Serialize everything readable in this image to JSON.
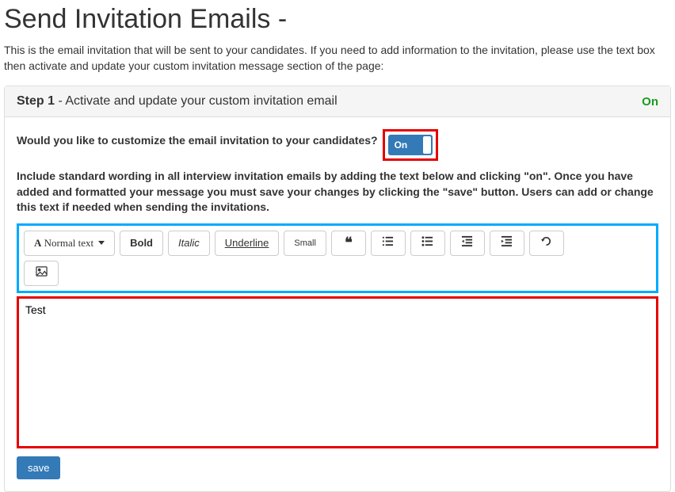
{
  "page": {
    "title": "Send Invitation Emails -",
    "intro": "This is the email invitation that will be sent to your candidates. If you need to add information to the invitation, please use the text box then activate and update your custom invitation message section of the page:"
  },
  "panel": {
    "step_label": "Step 1",
    "step_desc": " - Activate and update your custom invitation email",
    "status": "On"
  },
  "body": {
    "question": "Would you like to customize the email invitation to your candidates?",
    "toggle_label": "On",
    "instructions": "Include standard wording in all interview invitation emails by adding the text below and clicking \"on\". Once you have added and formatted your message you must save your changes by clicking the \"save\" button. Users can add or change this text if needed when sending the invitations."
  },
  "toolbar": {
    "style_label": "Normal text",
    "bold": "Bold",
    "italic": "Italic",
    "underline": "Underline",
    "small": "Small"
  },
  "editor": {
    "content": "Test"
  },
  "actions": {
    "save": "save"
  }
}
